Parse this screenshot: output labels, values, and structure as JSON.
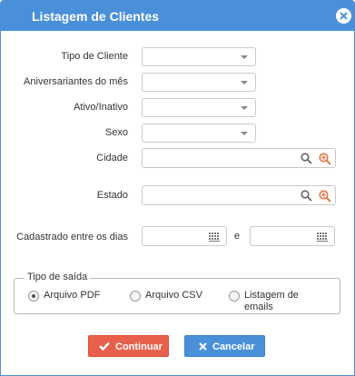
{
  "dialog": {
    "title": "Listagem de Clientes",
    "close_icon": "close-icon"
  },
  "form": {
    "tipo_cliente": {
      "label": "Tipo de Cliente",
      "value": ""
    },
    "aniversariantes": {
      "label": "Aniversariantes do mês",
      "value": ""
    },
    "ativo_inativo": {
      "label": "Ativo/Inativo",
      "value": ""
    },
    "sexo": {
      "label": "Sexo",
      "value": ""
    },
    "cidade": {
      "label": "Cidade",
      "value": ""
    },
    "estado": {
      "label": "Estado",
      "value": ""
    },
    "cadastrado": {
      "label": "Cadastrado entre os dias",
      "separator": "e",
      "start": "",
      "end": ""
    }
  },
  "output": {
    "legend": "Tipo de saída",
    "options": [
      {
        "label": "Arquivo PDF",
        "checked": true
      },
      {
        "label": "Arquivo CSV",
        "checked": false
      },
      {
        "label_line1": "Listagem de",
        "label_line2": "emails",
        "checked": false
      }
    ]
  },
  "buttons": {
    "continue_label": "Continuar",
    "cancel_label": "Cancelar"
  },
  "colors": {
    "primary": "#4a90d9",
    "continue": "#e8604c"
  }
}
